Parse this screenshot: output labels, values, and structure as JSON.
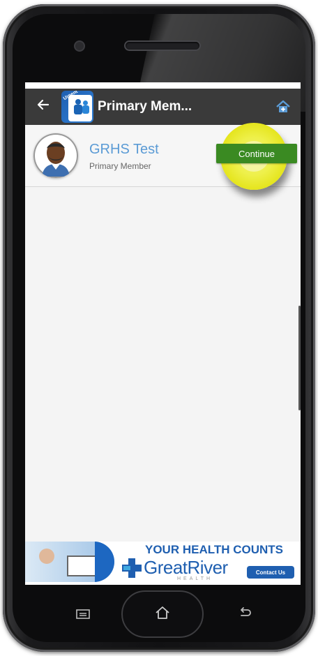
{
  "appbar": {
    "title": "Primary Mem...",
    "back_icon": "arrow-left-icon",
    "home_icon": "home-plus-icon",
    "logo_tag": "Urgent"
  },
  "member": {
    "name": "GRHS Test",
    "role": "Primary Member",
    "continue_label": "Continue"
  },
  "banner": {
    "headline": "YOUR HEALTH COUNTS",
    "brand": "GreatRiver",
    "sub": "HEALTH",
    "contact_label": "Contact Us"
  },
  "colors": {
    "appbar_bg": "#3a3a3a",
    "name_color": "#5b9bd5",
    "continue_bg": "#3a8a22",
    "highlight": "#e5e51d",
    "brand_blue": "#1f5fb0"
  }
}
